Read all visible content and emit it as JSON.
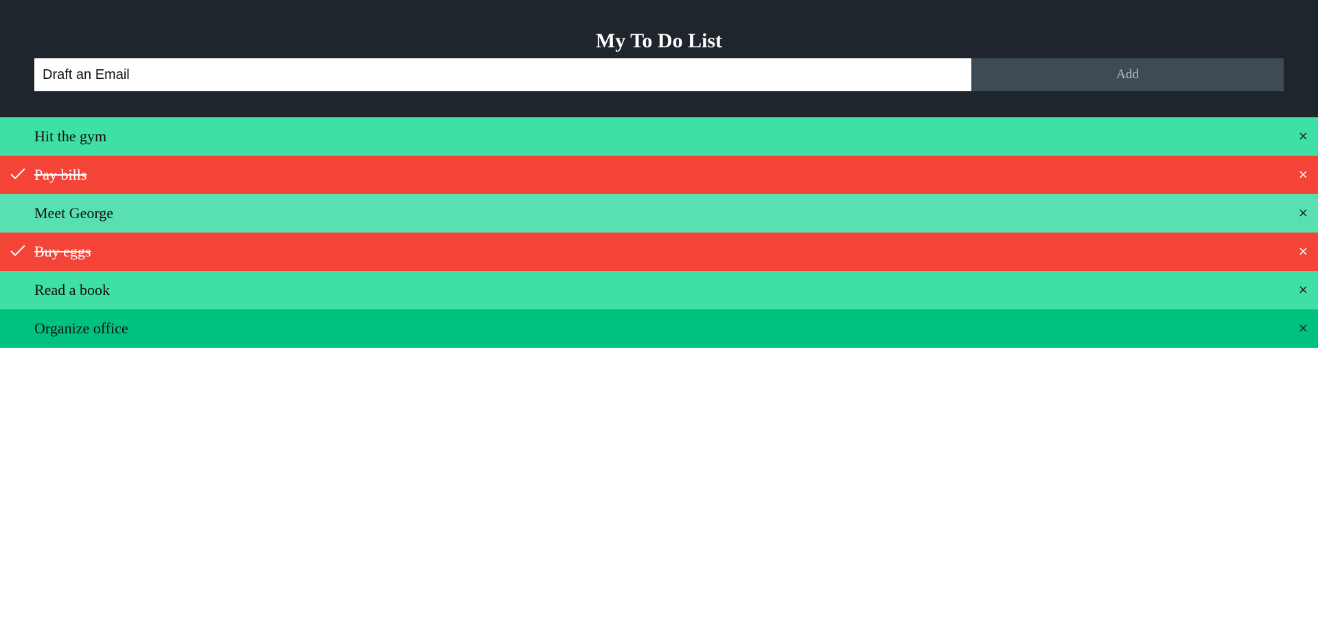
{
  "header": {
    "title": "My To Do List",
    "input_value": "Draft an Email",
    "add_label": "Add"
  },
  "todos": [
    {
      "label": "Hit the gym",
      "done": false,
      "color": "#3ee0a6"
    },
    {
      "label": "Pay bills",
      "done": true,
      "color": "#f44437"
    },
    {
      "label": "Meet George",
      "done": false,
      "color": "#58e0b0"
    },
    {
      "label": "Buy eggs",
      "done": true,
      "color": "#f44437"
    },
    {
      "label": "Read a book",
      "done": false,
      "color": "#3ee0a6"
    },
    {
      "label": "Organize office",
      "done": false,
      "color": "#00c27f"
    }
  ],
  "close_glyph": "×",
  "icons": {
    "check": "check-icon",
    "close": "close-icon"
  },
  "colors": {
    "header_bg": "#1e252d",
    "add_button_bg": "#3e4b54",
    "done_red": "#f44437"
  }
}
